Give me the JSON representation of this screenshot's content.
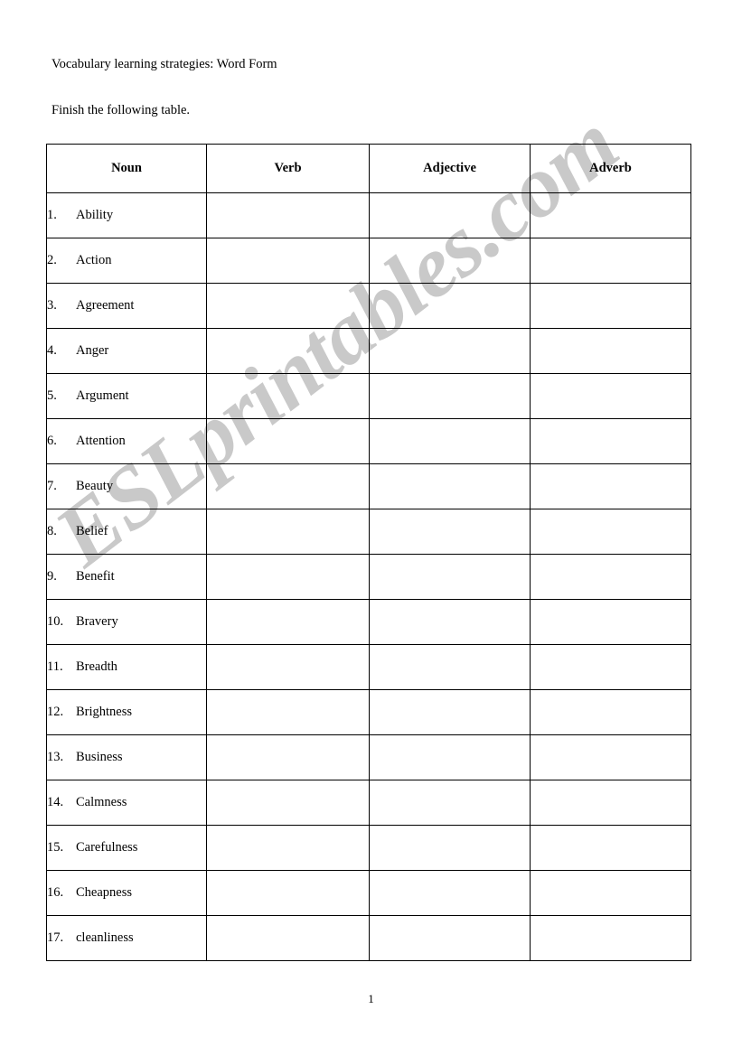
{
  "document": {
    "title": "Vocabulary learning strategies: Word Form",
    "instruction": "Finish the following table.",
    "page_number": "1",
    "watermark": "ESLprintables.com",
    "watermark_color": "#c9c9c9",
    "background_color": "#ffffff",
    "text_color": "#000000",
    "border_color": "#000000"
  },
  "table": {
    "headers": [
      "Noun",
      "Verb",
      "Adjective",
      "Adverb"
    ],
    "rows": [
      {
        "number": "1.",
        "noun": "Ability",
        "verb": "",
        "adjective": "",
        "adverb": ""
      },
      {
        "number": "2.",
        "noun": "Action",
        "verb": "",
        "adjective": "",
        "adverb": ""
      },
      {
        "number": "3.",
        "noun": "Agreement",
        "verb": "",
        "adjective": "",
        "adverb": ""
      },
      {
        "number": "4.",
        "noun": "Anger",
        "verb": "",
        "adjective": "",
        "adverb": ""
      },
      {
        "number": "5.",
        "noun": "Argument",
        "verb": "",
        "adjective": "",
        "adverb": ""
      },
      {
        "number": "6.",
        "noun": "Attention",
        "verb": "",
        "adjective": "",
        "adverb": ""
      },
      {
        "number": "7.",
        "noun": "Beauty",
        "verb": "",
        "adjective": "",
        "adverb": ""
      },
      {
        "number": "8.",
        "noun": "Belief",
        "verb": "",
        "adjective": "",
        "adverb": ""
      },
      {
        "number": "9.",
        "noun": "Benefit",
        "verb": "",
        "adjective": "",
        "adverb": ""
      },
      {
        "number": "10.",
        "noun": "Bravery",
        "verb": "",
        "adjective": "",
        "adverb": ""
      },
      {
        "number": "11.",
        "noun": "Breadth",
        "verb": "",
        "adjective": "",
        "adverb": ""
      },
      {
        "number": "12.",
        "noun": "Brightness",
        "verb": "",
        "adjective": "",
        "adverb": ""
      },
      {
        "number": "13.",
        "noun": "Business",
        "verb": "",
        "adjective": "",
        "adverb": ""
      },
      {
        "number": "14.",
        "noun": "Calmness",
        "verb": "",
        "adjective": "",
        "adverb": ""
      },
      {
        "number": "15.",
        "noun": "Carefulness",
        "verb": "",
        "adjective": "",
        "adverb": ""
      },
      {
        "number": "16.",
        "noun": "Cheapness",
        "verb": "",
        "adjective": "",
        "adverb": ""
      },
      {
        "number": "17.",
        "noun": "cleanliness",
        "verb": "",
        "adjective": "",
        "adverb": ""
      }
    ]
  }
}
